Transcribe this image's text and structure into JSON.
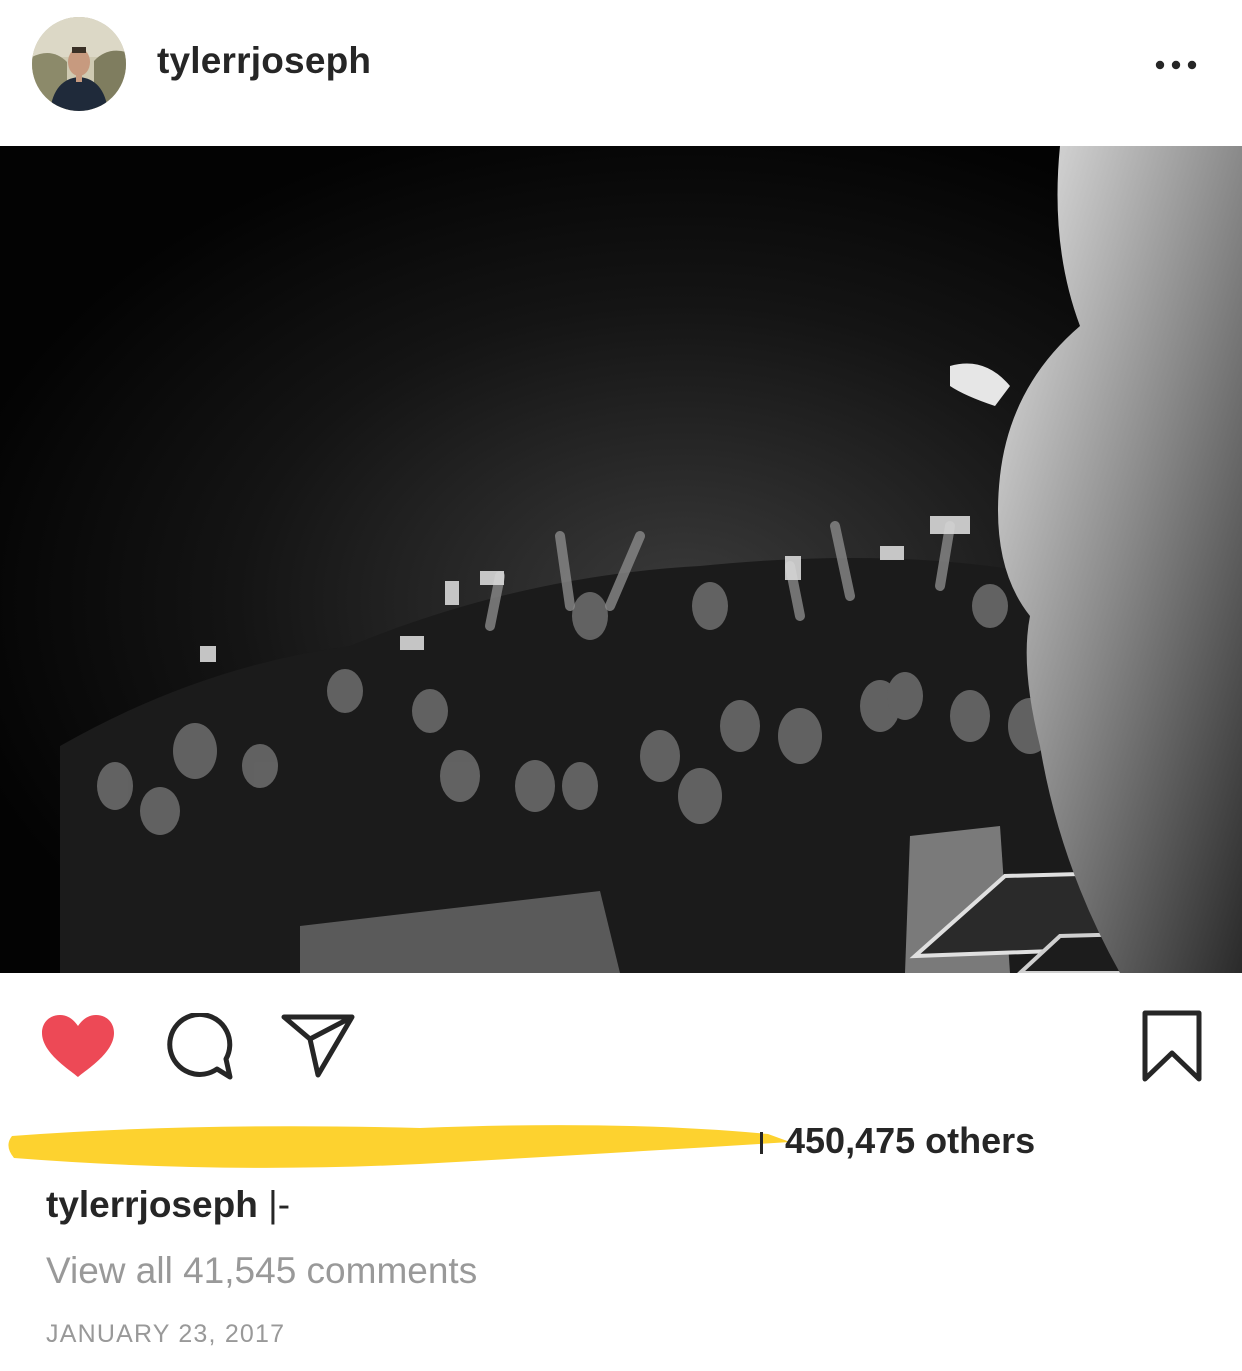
{
  "header": {
    "username": "tylerrjoseph",
    "avatar_icon": "profile-photo",
    "more_icon": "more-options-icon"
  },
  "post": {
    "photo_description": "concert-crowd-photo"
  },
  "actions": {
    "like_icon": "heart-icon",
    "like_active": true,
    "like_color": "#ED4956",
    "comment_icon": "comment-icon",
    "share_icon": "send-icon",
    "save_icon": "bookmark-icon"
  },
  "likes": {
    "text": "450,475 others",
    "redaction_color": "#FDD22F"
  },
  "caption": {
    "username": "tylerrjoseph",
    "text": "|-"
  },
  "comments": {
    "link_text": "View all 41,545 comments"
  },
  "meta": {
    "date": "JANUARY 23, 2017"
  }
}
